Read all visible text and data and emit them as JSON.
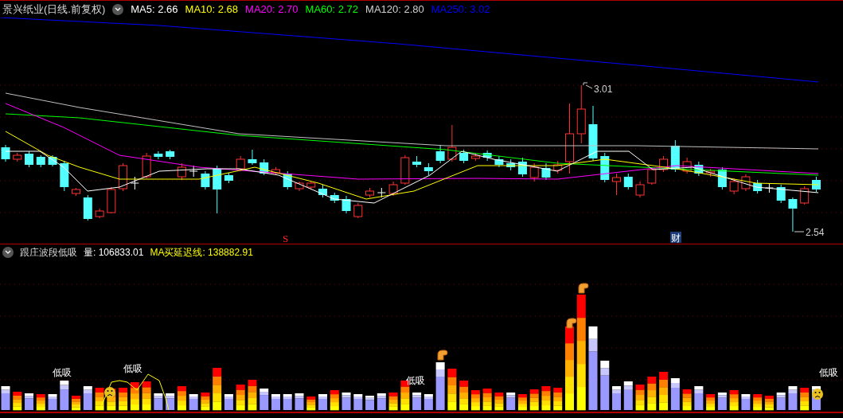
{
  "header": {
    "title": "景兴纸业(日线.前复权)",
    "ma_legend": [
      {
        "text": "MA5: 2.66",
        "color": "#ffffff"
      },
      {
        "text": "MA10: 2.68",
        "color": "#ffff00"
      },
      {
        "text": "MA20: 2.70",
        "color": "#ff00ff"
      },
      {
        "text": "MA60: 2.72",
        "color": "#00ff00"
      },
      {
        "text": "MA120: 2.80",
        "color": "#d0d0d0"
      },
      {
        "text": "MA250: 3.02",
        "color": "#0000ff"
      }
    ]
  },
  "price_chart": {
    "high_label": "3.01",
    "low_label": "2.54",
    "markers": [
      {
        "kind": "sell",
        "text": "S"
      },
      {
        "kind": "finance",
        "text": "财"
      }
    ]
  },
  "indicator": {
    "name": "跟庄波段低吸",
    "readings": [
      {
        "text": "量: 106833.01",
        "color": "#ffffff"
      },
      {
        "text": "MA买延迟线: 138882.91",
        "color": "#ffff00"
      }
    ],
    "signals": [
      "低吸",
      "低吸",
      "低吸",
      "低吸"
    ]
  }
}
